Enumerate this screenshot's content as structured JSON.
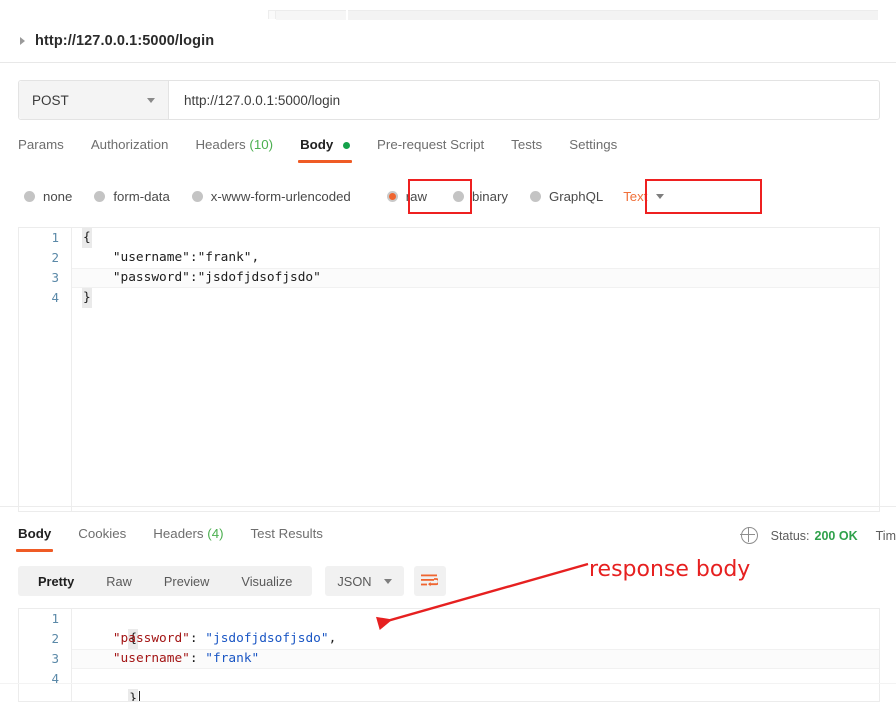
{
  "window": {
    "collapsed_request_title": "http://127.0.0.1:5000/login",
    "collapse_caret_icon": "caret-right-icon"
  },
  "request": {
    "method": "POST",
    "method_caret_icon": "chevron-down-icon",
    "url": "http://127.0.0.1:5000/login",
    "tabs": [
      {
        "label": "Params",
        "active": false
      },
      {
        "label": "Authorization",
        "active": false
      },
      {
        "label": "Headers",
        "count": "(10)",
        "active": false
      },
      {
        "label": "Body",
        "active": true,
        "dot": true
      },
      {
        "label": "Pre-request Script",
        "active": false
      },
      {
        "label": "Tests",
        "active": false
      },
      {
        "label": "Settings",
        "active": false
      }
    ],
    "body_types": [
      {
        "label": "none",
        "selected": false
      },
      {
        "label": "form-data",
        "selected": false
      },
      {
        "label": "x-www-form-urlencoded",
        "selected": false
      },
      {
        "label": "raw",
        "selected": true
      },
      {
        "label": "binary",
        "selected": false
      },
      {
        "label": "GraphQL",
        "selected": false
      }
    ],
    "raw_format": "Text",
    "raw_format_caret_icon": "chevron-down-icon",
    "body_lines": [
      {
        "n": "1",
        "text": "{"
      },
      {
        "n": "2",
        "text": "    \"username\":\"frank\","
      },
      {
        "n": "3",
        "text": "    \"password\":\"jsdofjdsofjsdo\""
      },
      {
        "n": "4",
        "text": "}"
      }
    ]
  },
  "response": {
    "tabs": [
      {
        "label": "Body",
        "active": true
      },
      {
        "label": "Cookies",
        "active": false
      },
      {
        "label": "Headers",
        "count": "(4)",
        "active": false
      },
      {
        "label": "Test Results",
        "active": false
      }
    ],
    "globe_icon": "globe-icon",
    "status_label": "Status:",
    "status_value": "200 OK",
    "time_label": "Tim",
    "view_modes": [
      {
        "label": "Pretty",
        "active": true
      },
      {
        "label": "Raw",
        "active": false
      },
      {
        "label": "Preview",
        "active": false
      },
      {
        "label": "Visualize",
        "active": false
      }
    ],
    "language": "JSON",
    "language_caret_icon": "chevron-down-icon",
    "wrap_icon": "word-wrap-icon",
    "body_lines": [
      {
        "n": "1",
        "key": "",
        "val": "",
        "punct": "{"
      },
      {
        "n": "2",
        "key": "\"password\"",
        "val": "\"jsdofjdsofjsdo\"",
        "punct": ","
      },
      {
        "n": "3",
        "key": "\"username\"",
        "val": "\"frank\"",
        "punct": ""
      },
      {
        "n": "4",
        "key": "",
        "val": "",
        "punct": "}"
      }
    ]
  },
  "annotations": {
    "response_body_label": "response body",
    "arrow_icon": "arrow-pointing-down-left-icon",
    "highlight_color": "#ee2020",
    "accent_color": "#ef5b25",
    "status_ok_color": "#2fa14b"
  },
  "bottom_faint_text": ""
}
